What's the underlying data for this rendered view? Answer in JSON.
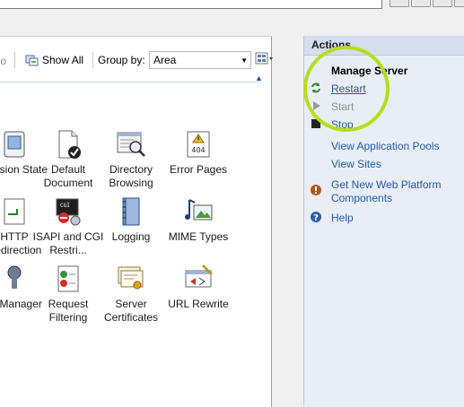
{
  "filter_bar": {
    "go_label": "Go",
    "show_all_label": "Show All",
    "group_by_label": "Group by:",
    "group_by_value": "Area"
  },
  "features": [
    {
      "name": "session-state",
      "label": "Session State"
    },
    {
      "name": "default-document",
      "label": "Default Document"
    },
    {
      "name": "directory-browsing",
      "label": "Directory Browsing"
    },
    {
      "name": "error-pages",
      "label": "Error Pages"
    },
    {
      "name": "http-redirection",
      "label": "HTTP Redirection"
    },
    {
      "name": "isapi-cgi",
      "label": "ISAPI and CGI Restri..."
    },
    {
      "name": "logging",
      "label": "Logging"
    },
    {
      "name": "mime-types",
      "label": "MIME Types"
    },
    {
      "name": "ip-manager",
      "label": "IP Manager"
    },
    {
      "name": "request-filtering",
      "label": "Request Filtering"
    },
    {
      "name": "server-certificates",
      "label": "Server Certificates"
    },
    {
      "name": "url-rewrite",
      "label": "URL Rewrite"
    }
  ],
  "actions": {
    "title": "Actions",
    "section": "Manage Server",
    "restart": "Restart",
    "start": "Start",
    "stop": "Stop",
    "view_app_pools": "View Application Pools",
    "view_sites": "View Sites",
    "web_platform": "Get New Web Platform Components",
    "help": "Help"
  },
  "colors": {
    "link": "#2159a5",
    "highlight": "#b8dc1e",
    "actions_bg": "#e9eef6"
  }
}
